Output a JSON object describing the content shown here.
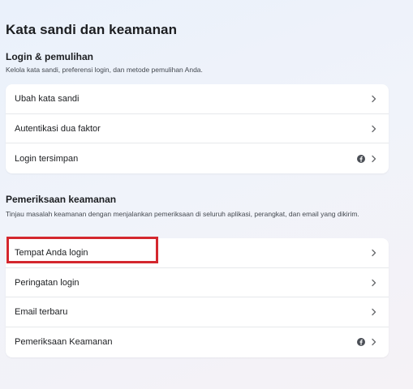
{
  "page": {
    "title": "Kata sandi dan keamanan"
  },
  "login_section": {
    "title": "Login & pemulihan",
    "description": "Kelola kata sandi, preferensi login, dan metode pemulihan Anda.",
    "items": [
      {
        "label": "Ubah kata sandi",
        "icon": "chevron-right-icon"
      },
      {
        "label": "Autentikasi dua faktor",
        "icon": "chevron-right-icon"
      },
      {
        "label": "Login tersimpan",
        "icon": "chevron-right-icon",
        "badge_icon": "facebook-icon"
      }
    ]
  },
  "security_section": {
    "title": "Pemeriksaan keamanan",
    "description": "Tinjau masalah keamanan dengan menjalankan pemeriksaan di seluruh aplikasi, perangkat, dan email yang dikirim.",
    "items": [
      {
        "label": "Tempat Anda login",
        "icon": "chevron-right-icon",
        "highlighted": true
      },
      {
        "label": "Peringatan login",
        "icon": "chevron-right-icon"
      },
      {
        "label": "Email terbaru",
        "icon": "chevron-right-icon"
      },
      {
        "label": "Pemeriksaan Keamanan",
        "icon": "chevron-right-icon",
        "badge_icon": "facebook-icon"
      }
    ]
  },
  "colors": {
    "highlight_border": "#d4272e",
    "icon_gray": "#65676b"
  }
}
